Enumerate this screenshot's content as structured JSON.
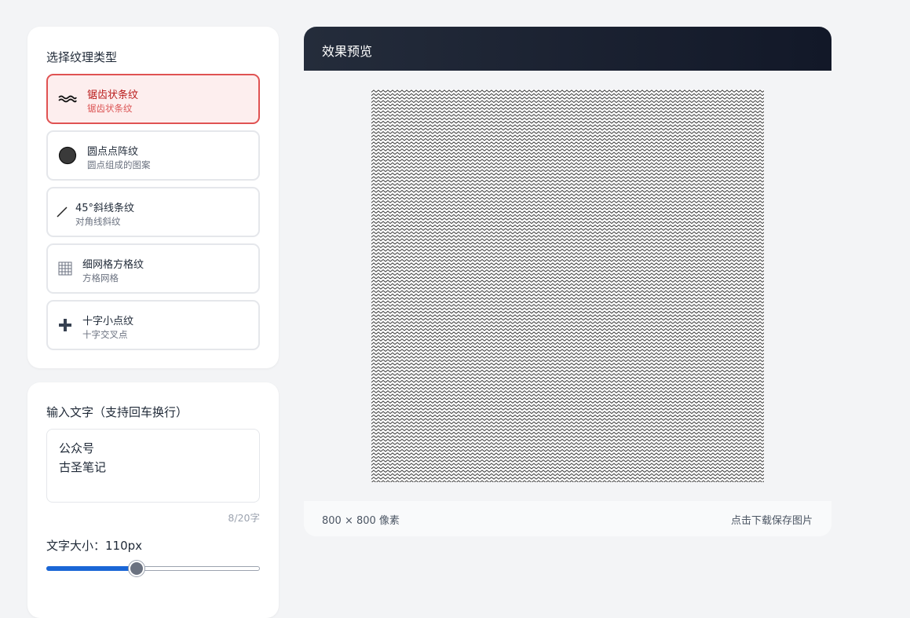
{
  "texture_panel": {
    "title": "选择纹理类型",
    "options": [
      {
        "name": "锯齿状条纹",
        "desc": "锯齿状条纹",
        "icon": "zigzag-icon",
        "selected": true
      },
      {
        "name": "圆点点阵纹",
        "desc": "圆点组成的图案",
        "icon": "dot-icon",
        "selected": false
      },
      {
        "name": "45°斜线条纹",
        "desc": "对角线斜纹",
        "icon": "diagonal-line-icon",
        "selected": false
      },
      {
        "name": "细网格方格纹",
        "desc": "方格网格",
        "icon": "grid-icon",
        "selected": false
      },
      {
        "name": "十字小点纹",
        "desc": "十字交叉点",
        "icon": "cross-icon",
        "selected": false
      }
    ]
  },
  "text_panel": {
    "title": "输入文字（支持回车换行）",
    "text_value": "公众号\n古圣笔记",
    "char_count": "8/20字",
    "size_label": "文字大小：110px",
    "size_slider_fraction": 0.42
  },
  "preview": {
    "title": "效果预览",
    "dims": "800 × 800 像素",
    "download": "点击下载保存图片"
  },
  "colors": {
    "accent": "#e05252",
    "selected_bg": "#fdeeee",
    "slider_fill": "#1a66d6",
    "header_dark": "#1a2030"
  }
}
